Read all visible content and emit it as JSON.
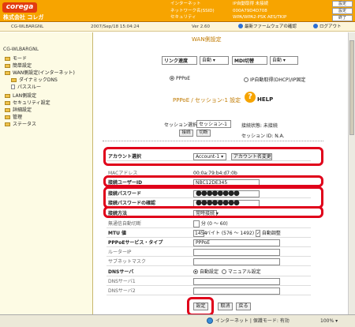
{
  "header": {
    "logo": "corega",
    "company": "株式会社 コレガ",
    "info": [
      {
        "label": "インターネット",
        "value": "IP自動取得 未接続"
      },
      {
        "label": "ネットワーク名(SSID)",
        "value": "000A79D4D708"
      },
      {
        "label": "セキュリティ",
        "value": "WPA/WPA2-PSK AES/TKIP"
      }
    ],
    "buttons": [
      "設定",
      "設定",
      "終了"
    ]
  },
  "statusbar": {
    "model": "CG-WLBARGNL",
    "datetime": "2007/Sep/18 15:04:24",
    "version": "Ver 2.60",
    "firmware_link": "最新ファームウェアの確認",
    "logout": "ログアウト"
  },
  "sidebar": {
    "title": "CG-WLBARGNL",
    "items": [
      {
        "label": "モード",
        "icon": "folder-icon"
      },
      {
        "label": "簡単設定",
        "icon": "folder-icon"
      },
      {
        "label": "WAN側設定(インターネット)",
        "icon": "folder-icon"
      },
      {
        "label": "ダイナミックDNS",
        "icon": "folder-icon"
      },
      {
        "label": "パススルー",
        "icon": "page-icon"
      },
      {
        "label": "LAN側設定",
        "icon": "folder-icon"
      },
      {
        "label": "セキュリティ設定",
        "icon": "folder-icon"
      },
      {
        "label": "詳細設定",
        "icon": "folder-icon"
      },
      {
        "label": "管理",
        "icon": "folder-icon"
      },
      {
        "label": "ステータス",
        "icon": "folder-icon"
      }
    ]
  },
  "wan": {
    "title": "WAN側設定",
    "link_speed_label": "リンク速度",
    "link_speed_value": "自動",
    "mdi_label": "MDI切替",
    "mdi_value": "自動",
    "radio_pppoe": "PPPoE",
    "radio_dhcp": "IP自動取得(DHCP)/IP固定"
  },
  "pppoe": {
    "title": "PPPoE / セッション-1 設定",
    "help": "HELP",
    "session_select_label": "セッション選択",
    "session_select_value": "セッション-1",
    "add_button": "接続",
    "cut_button": "切断",
    "connection_status": "接続状態: 未接続",
    "session_id": "セッション ID: N.A."
  },
  "form": {
    "account_select_label": "アカウント選択",
    "account_select_value": "Account-1",
    "account_rename_button": "アカウント名変更",
    "mac_label": "MACアドレス",
    "mac_value": "00:0a:79:b4:d7:0b",
    "user_id_label": "接続ユーザーID",
    "user_id_value": "NBC12DE345",
    "password_label": "接続パスワード",
    "password_value": "●●●●●●●●",
    "password_confirm_label": "接続パスワードの確認",
    "password_confirm_value": "●●●●●●●●",
    "method_label": "接続方法",
    "method_value": "常時接続",
    "idle_label": "無通信自動切断",
    "idle_value": "分 (0 ～ 60)",
    "mtu_label": "MTU 値",
    "mtu_value": "1454",
    "mtu_unit": "バイト (576 ～ 1492)",
    "mtu_auto": "自動調整",
    "service_label": "PPPoEサービス・タイプ",
    "service_value": "PPPoE",
    "router_ip_label": "ルーターIP",
    "subnet_label": "サブネットマスク",
    "dns_label": "DNSサーバ",
    "dns_auto": "自動設定",
    "dns_manual": "マニュアル設定",
    "dns1_label": "DNSサーバ1",
    "dns2_label": "DNSサーバ2"
  },
  "actions": {
    "save": "設定",
    "cancel": "取消",
    "back": "戻る"
  },
  "footer": {
    "zone": "インターネット | 保護モード: 有効",
    "zoom": "100%"
  },
  "colors": {
    "header": "#f7a400",
    "highlight": "#e0001a",
    "title": "#c07a00"
  }
}
